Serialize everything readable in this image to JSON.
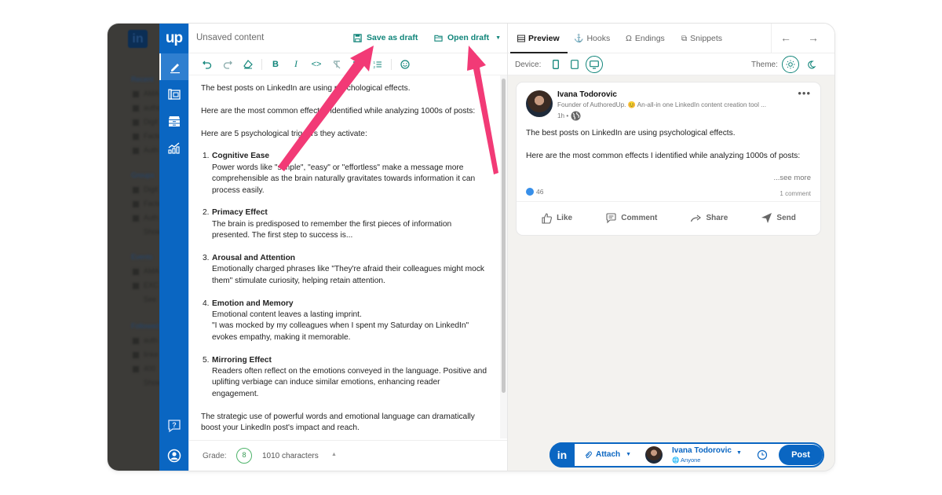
{
  "linkedin_sidebar": {
    "sections": [
      {
        "title": "Recent",
        "items": [
          "AMA",
          "authc",
          "Digit",
          "Facto",
          "Auth"
        ]
      },
      {
        "title": "Groups",
        "items": [
          "Digit",
          "Facto",
          "Auth",
          "Show"
        ]
      },
      {
        "title": "Events",
        "items": [
          "AMA",
          "EXC",
          "See"
        ]
      },
      {
        "title": "Followed",
        "items": [
          "auth",
          "linke",
          "400",
          "Show"
        ]
      }
    ]
  },
  "rail": {
    "logo": "up",
    "items": [
      {
        "name": "editor",
        "icon": "pencil-icon",
        "active": true
      },
      {
        "name": "library",
        "icon": "library-icon",
        "active": false
      },
      {
        "name": "archive",
        "icon": "archive-icon",
        "active": false
      },
      {
        "name": "analytics",
        "icon": "chart-icon",
        "active": false
      }
    ],
    "bottom": [
      {
        "name": "help",
        "icon": "help-icon"
      },
      {
        "name": "profile",
        "icon": "user-icon"
      }
    ]
  },
  "editor": {
    "title": "Unsaved content",
    "save_draft_label": "Save as draft",
    "open_draft_label": "Open draft",
    "toolbar": [
      "undo",
      "redo",
      "clear-format",
      "bold",
      "italic",
      "code",
      "strikethrough-clear",
      "bullet-list",
      "numbered-list",
      "emoji"
    ],
    "content": {
      "intro_1": "The best posts on LinkedIn are using psychological effects.",
      "intro_2": "Here are the most common effects I identified while analyzing 1000s of posts:",
      "intro_3": "Here are 5 psychological triggers they activate:",
      "items": [
        {
          "num": "1.",
          "title": "Cognitive Ease",
          "body": "Power words like \"simple\", \"easy\" or \"effortless\" make a message more comprehensible as the brain naturally gravitates towards information it can process easily."
        },
        {
          "num": "2.",
          "title": "Primacy Effect",
          "body": "The brain is predisposed to remember the first pieces of information presented. The first step to success is..."
        },
        {
          "num": "3.",
          "title": "Arousal and Attention",
          "body": "Emotionally charged phrases like \"They're afraid their colleagues might mock them\" stimulate curiosity, helping retain attention."
        },
        {
          "num": "4.",
          "title": "Emotion and Memory",
          "body": "Emotional content leaves a lasting imprint.\n\"I was mocked by my colleagues when I spent my Saturday on LinkedIn\" evokes empathy, making it memorable."
        },
        {
          "num": "5.",
          "title": "Mirroring Effect",
          "body": "Readers often reflect on the emotions conveyed in the language. Positive and uplifting verbiage can induce similar emotions, enhancing reader engagement."
        }
      ],
      "outro": "The strategic use of powerful words and emotional language can dramatically boost your LinkedIn post's impact and reach."
    },
    "footer": {
      "grade_label": "Grade:",
      "grade_value": "8",
      "characters": "1010 characters"
    }
  },
  "preview": {
    "tabs": [
      {
        "label": "Preview",
        "active": true
      },
      {
        "label": "Hooks",
        "active": false
      },
      {
        "label": "Endings",
        "active": false
      },
      {
        "label": "Snippets",
        "active": false
      }
    ],
    "device_label": "Device:",
    "devices": [
      "mobile",
      "tablet",
      "desktop"
    ],
    "selected_device": "desktop",
    "theme_label": "Theme:",
    "themes": [
      "light",
      "dark"
    ],
    "selected_theme": "light",
    "post": {
      "author": "Ivana Todorovic",
      "headline": "Founder of AuthoredUp. 😊 An-all-in one LinkedIn content creation tool ...",
      "time": "1h •",
      "line_1": "The best posts on LinkedIn are using psychological effects.",
      "line_2": "Here are the most common effects I identified while analyzing 1000s of posts:",
      "see_more": "...see more",
      "reactions": "46",
      "comments": "1 comment",
      "actions": [
        "Like",
        "Comment",
        "Share",
        "Send"
      ]
    },
    "postbar": {
      "attach_label": "Attach",
      "author": "Ivana Todorovic",
      "visibility": "Anyone",
      "post_label": "Post"
    }
  },
  "colors": {
    "brand_blue": "#0a66c2",
    "accent_teal": "#11857a",
    "annotation_pink": "#f23a76",
    "grade_green": "#4fb46b"
  }
}
